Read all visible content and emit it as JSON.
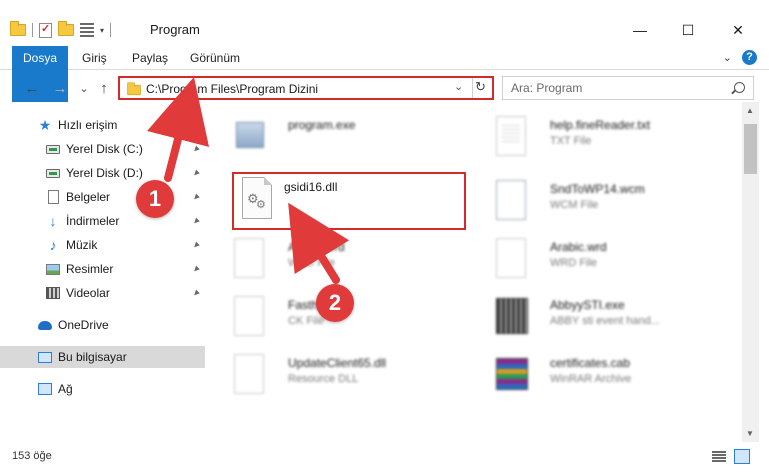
{
  "window": {
    "title": "Program",
    "minimize_glyph": "—",
    "maximize_glyph": "☐",
    "close_glyph": "✕"
  },
  "quick_access_toolbar": {
    "icons": [
      "folder-icon",
      "properties-icon",
      "new-folder-icon",
      "view-icon"
    ],
    "customize_glyph": "▾"
  },
  "ribbon": {
    "tabs": [
      {
        "label": "Dosya",
        "active": true
      },
      {
        "label": "Giriş"
      },
      {
        "label": "Paylaş"
      },
      {
        "label": "Görünüm"
      }
    ],
    "expand_glyph": "⌄",
    "help_glyph": "?"
  },
  "navigation": {
    "back_glyph": "←",
    "forward_glyph": "→",
    "recent_glyph": "⌄",
    "up_glyph": "↑",
    "address": "C:\\Program Files\\Program Dizini",
    "address_dropdown_glyph": "⌄",
    "refresh_glyph": "↻",
    "search_placeholder": "Ara: Program"
  },
  "sidebar": {
    "items": [
      {
        "label": "Hızlı erişim",
        "icon": "star-icon",
        "pinned": false
      },
      {
        "label": "Yerel Disk (C:)",
        "icon": "disk-icon",
        "pinned": true
      },
      {
        "label": "Yerel Disk (D:)",
        "icon": "disk-icon",
        "pinned": true
      },
      {
        "label": "Belgeler",
        "icon": "documents-icon",
        "pinned": true
      },
      {
        "label": "İndirmeler",
        "icon": "downloads-icon",
        "pinned": true
      },
      {
        "label": "Müzik",
        "icon": "music-icon",
        "pinned": true
      },
      {
        "label": "Resimler",
        "icon": "pictures-icon",
        "pinned": true
      },
      {
        "label": "Videolar",
        "icon": "videos-icon",
        "pinned": true
      },
      {
        "label": "OneDrive",
        "icon": "onedrive-icon"
      },
      {
        "label": "Bu bilgisayar",
        "icon": "this-pc-icon",
        "selected": true
      },
      {
        "label": "Ağ",
        "icon": "network-icon"
      }
    ],
    "pin_glyph": "📌"
  },
  "files": [
    {
      "name": "program.exe",
      "type": ""
    },
    {
      "name": "help.fineReader.txt",
      "type": "TXT File"
    },
    {
      "name": "gsidi16.dll",
      "type": ""
    },
    {
      "name": "SndToWP14.wcm",
      "type": "WCM File"
    },
    {
      "name": "Arabic.wrd",
      "type": "WRD File"
    },
    {
      "name": "Arabic.wrd",
      "type": "WRD File"
    },
    {
      "name": "Fasthr",
      "type": "CK File"
    },
    {
      "name": "AbbyySTI.exe",
      "type": "ABBY sti event hand..."
    },
    {
      "name": "UpdateClient65.dll",
      "type": "Resource DLL"
    },
    {
      "name": "certificates.cab",
      "type": "WinRAR Archive"
    }
  ],
  "highlighted_file": {
    "name": "gsidi16.dll"
  },
  "annotations": {
    "step1": "1",
    "step2": "2",
    "color": "#e03a3a"
  },
  "status": {
    "item_count": "153 öğe"
  },
  "colors": {
    "accent": "#1979ca",
    "highlight_border": "#d42a2a",
    "selected_bg": "#d9d9d9"
  }
}
